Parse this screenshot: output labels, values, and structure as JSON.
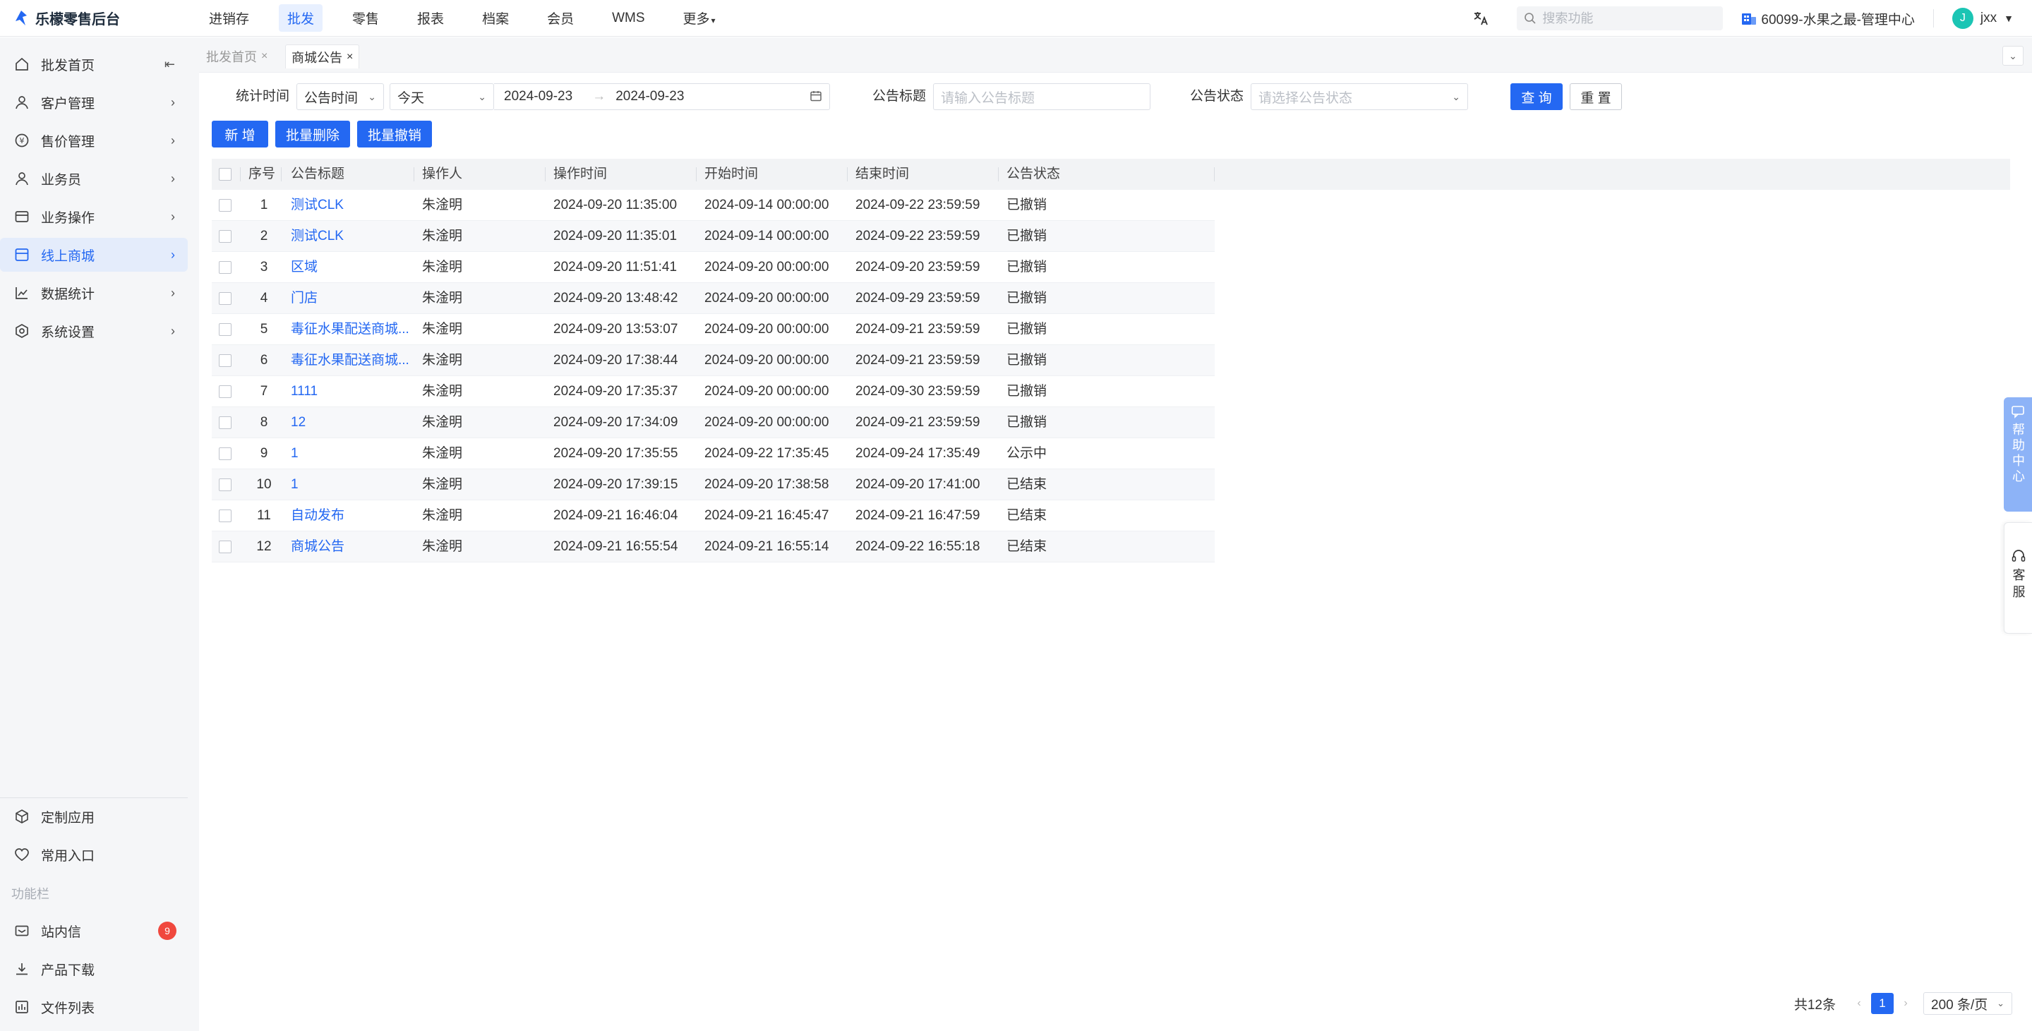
{
  "brand": {
    "name": "乐檬零售后台",
    "color": "#2468f2"
  },
  "topnav": {
    "items": [
      "进销存",
      "批发",
      "零售",
      "报表",
      "档案",
      "会员",
      "WMS",
      "更多"
    ],
    "active_index": 1
  },
  "header": {
    "search_placeholder": "搜索功能",
    "org": "60099-水果之最-管理中心",
    "user_initial": "J",
    "user_name": "jxx"
  },
  "sidebar": {
    "items": [
      {
        "label": "批发首页",
        "icon": "home-icon"
      },
      {
        "label": "客户管理",
        "icon": "user-icon"
      },
      {
        "label": "售价管理",
        "icon": "price-icon"
      },
      {
        "label": "业务员",
        "icon": "user-icon"
      },
      {
        "label": "业务操作",
        "icon": "card-icon"
      },
      {
        "label": "线上商城",
        "icon": "store-icon",
        "active": true
      },
      {
        "label": "数据统计",
        "icon": "chart-icon"
      },
      {
        "label": "系统设置",
        "icon": "settings-icon"
      }
    ],
    "bottom_items": [
      {
        "label": "定制应用",
        "icon": "cube-icon"
      },
      {
        "label": "常用入口",
        "icon": "heart-icon"
      }
    ],
    "section_label": "功能栏",
    "func_items": [
      {
        "label": "站内信",
        "icon": "mail-icon",
        "badge": "9"
      },
      {
        "label": "产品下载",
        "icon": "download-icon"
      },
      {
        "label": "文件列表",
        "icon": "file-list-icon"
      }
    ]
  },
  "tabs": [
    {
      "label": "批发首页",
      "active": false
    },
    {
      "label": "商城公告",
      "active": true
    }
  ],
  "filters": {
    "stat_time_label": "统计时间",
    "time_type": "公告时间",
    "period": "今天",
    "date_start": "2024-09-23",
    "date_sep": "→",
    "date_end": "2024-09-23",
    "title_label": "公告标题",
    "title_placeholder": "请输入公告标题",
    "status_label": "公告状态",
    "status_placeholder": "请选择公告状态",
    "query_btn": "查 询",
    "reset_btn": "重 置"
  },
  "actions": {
    "add": "新 增",
    "batch_delete": "批量删除",
    "batch_revoke": "批量撤销"
  },
  "table": {
    "columns": [
      "序号",
      "公告标题",
      "操作人",
      "操作时间",
      "开始时间",
      "结束时间",
      "公告状态"
    ],
    "rows": [
      {
        "no": "1",
        "title": "测试CLK",
        "operator": "朱淦明",
        "op_time": "2024-09-20 11:35:00",
        "start": "2024-09-14 00:00:00",
        "end": "2024-09-22 23:59:59",
        "status": "已撤销"
      },
      {
        "no": "2",
        "title": "测试CLK",
        "operator": "朱淦明",
        "op_time": "2024-09-20 11:35:01",
        "start": "2024-09-14 00:00:00",
        "end": "2024-09-22 23:59:59",
        "status": "已撤销"
      },
      {
        "no": "3",
        "title": "区域",
        "operator": "朱淦明",
        "op_time": "2024-09-20 11:51:41",
        "start": "2024-09-20 00:00:00",
        "end": "2024-09-20 23:59:59",
        "status": "已撤销"
      },
      {
        "no": "4",
        "title": "门店",
        "operator": "朱淦明",
        "op_time": "2024-09-20 13:48:42",
        "start": "2024-09-20 00:00:00",
        "end": "2024-09-29 23:59:59",
        "status": "已撤销"
      },
      {
        "no": "5",
        "title": "毒征水果配送商城...",
        "operator": "朱淦明",
        "op_time": "2024-09-20 13:53:07",
        "start": "2024-09-20 00:00:00",
        "end": "2024-09-21 23:59:59",
        "status": "已撤销"
      },
      {
        "no": "6",
        "title": "毒征水果配送商城...",
        "operator": "朱淦明",
        "op_time": "2024-09-20 17:38:44",
        "start": "2024-09-20 00:00:00",
        "end": "2024-09-21 23:59:59",
        "status": "已撤销"
      },
      {
        "no": "7",
        "title": "1111",
        "operator": "朱淦明",
        "op_time": "2024-09-20 17:35:37",
        "start": "2024-09-20 00:00:00",
        "end": "2024-09-30 23:59:59",
        "status": "已撤销"
      },
      {
        "no": "8",
        "title": "12",
        "operator": "朱淦明",
        "op_time": "2024-09-20 17:34:09",
        "start": "2024-09-20 00:00:00",
        "end": "2024-09-21 23:59:59",
        "status": "已撤销"
      },
      {
        "no": "9",
        "title": "1",
        "operator": "朱淦明",
        "op_time": "2024-09-20 17:35:55",
        "start": "2024-09-22 17:35:45",
        "end": "2024-09-24 17:35:49",
        "status": "公示中"
      },
      {
        "no": "10",
        "title": "1",
        "operator": "朱淦明",
        "op_time": "2024-09-20 17:39:15",
        "start": "2024-09-20 17:38:58",
        "end": "2024-09-20 17:41:00",
        "status": "已结束"
      },
      {
        "no": "11",
        "title": "自动发布",
        "operator": "朱淦明",
        "op_time": "2024-09-21 16:46:04",
        "start": "2024-09-21 16:45:47",
        "end": "2024-09-21 16:47:59",
        "status": "已结束"
      },
      {
        "no": "12",
        "title": "商城公告",
        "operator": "朱淦明",
        "op_time": "2024-09-21 16:55:54",
        "start": "2024-09-21 16:55:14",
        "end": "2024-09-22 16:55:18",
        "status": "已结束"
      }
    ]
  },
  "pagination": {
    "total": "共12条",
    "current_page": "1",
    "page_size": "200 条/页"
  },
  "float": {
    "help": "帮助中心",
    "service": "客服"
  }
}
